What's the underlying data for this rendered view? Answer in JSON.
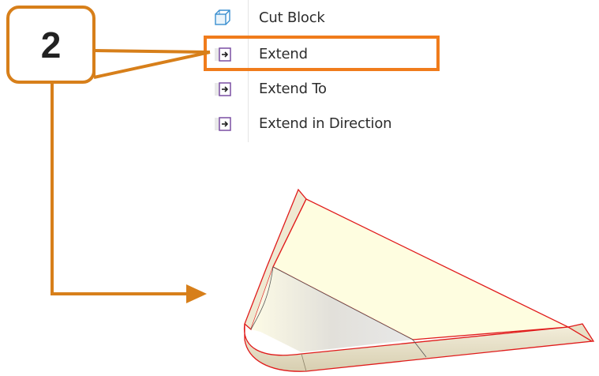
{
  "menu": {
    "items": [
      {
        "label": "Cut Block",
        "icon": "cut-block-icon"
      },
      {
        "label": "Extend",
        "icon": "extend-icon"
      },
      {
        "label": "Extend To",
        "icon": "extend-to-icon"
      },
      {
        "label": "Extend in Direction",
        "icon": "extend-in-direction-icon"
      }
    ]
  },
  "callout": {
    "number": "2"
  },
  "colors": {
    "accent": "#f07c1c",
    "callout_border": "#d77f1a",
    "face": "#fefde0",
    "edge": "#e01b1b"
  }
}
